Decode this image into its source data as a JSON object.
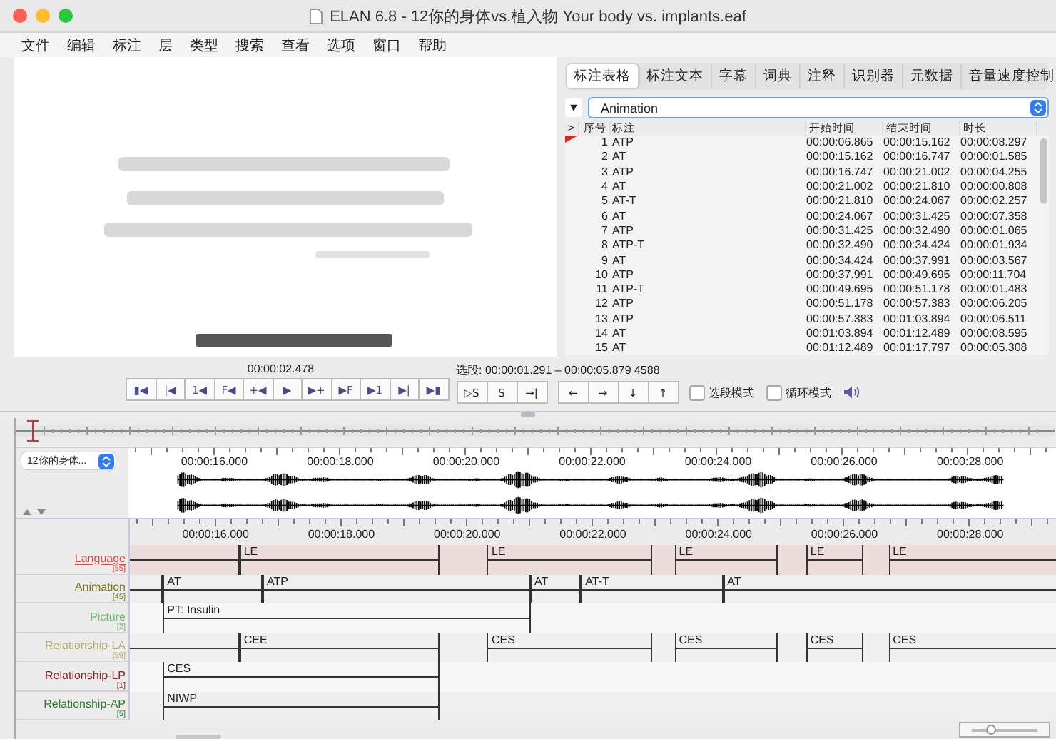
{
  "window": {
    "title": "ELAN 6.8 - 12你的身体vs.植入物 Your body vs. implants.eaf"
  },
  "menu": [
    "文件",
    "编辑",
    "标注",
    "层",
    "类型",
    "搜索",
    "查看",
    "选项",
    "窗口",
    "帮助"
  ],
  "tabs": [
    {
      "label": "标注表格",
      "selected": true
    },
    {
      "label": "标注文本",
      "selected": false
    },
    {
      "label": "字幕",
      "selected": false
    },
    {
      "label": "词典",
      "selected": false
    },
    {
      "label": "注释",
      "selected": false
    },
    {
      "label": "识别器",
      "selected": false
    },
    {
      "label": "元数据",
      "selected": false
    },
    {
      "label": "音量速度控制",
      "selected": false
    }
  ],
  "tier_selector": {
    "toggle": "▼",
    "value": "Animation"
  },
  "table": {
    "columns": [
      ">",
      "序号",
      "标注",
      "开始时间",
      "结束时间",
      "时长"
    ],
    "rows": [
      {
        "n": "1",
        "annotation": "ATP",
        "start": "00:00:06.865",
        "end": "00:00:15.162",
        "duration": "00:00:08.297",
        "current": true
      },
      {
        "n": "2",
        "annotation": "AT",
        "start": "00:00:15.162",
        "end": "00:00:16.747",
        "duration": "00:00:01.585",
        "current": false
      },
      {
        "n": "3",
        "annotation": "ATP",
        "start": "00:00:16.747",
        "end": "00:00:21.002",
        "duration": "00:00:04.255",
        "current": false
      },
      {
        "n": "4",
        "annotation": "AT",
        "start": "00:00:21.002",
        "end": "00:00:21.810",
        "duration": "00:00:00.808",
        "current": false
      },
      {
        "n": "5",
        "annotation": "AT-T",
        "start": "00:00:21.810",
        "end": "00:00:24.067",
        "duration": "00:00:02.257",
        "current": false
      },
      {
        "n": "6",
        "annotation": "AT",
        "start": "00:00:24.067",
        "end": "00:00:31.425",
        "duration": "00:00:07.358",
        "current": false
      },
      {
        "n": "7",
        "annotation": "ATP",
        "start": "00:00:31.425",
        "end": "00:00:32.490",
        "duration": "00:00:01.065",
        "current": false
      },
      {
        "n": "8",
        "annotation": "ATP-T",
        "start": "00:00:32.490",
        "end": "00:00:34.424",
        "duration": "00:00:01.934",
        "current": false
      },
      {
        "n": "9",
        "annotation": "AT",
        "start": "00:00:34.424",
        "end": "00:00:37.991",
        "duration": "00:00:03.567",
        "current": false
      },
      {
        "n": "10",
        "annotation": "ATP",
        "start": "00:00:37.991",
        "end": "00:00:49.695",
        "duration": "00:00:11.704",
        "current": false
      },
      {
        "n": "11",
        "annotation": "ATP-T",
        "start": "00:00:49.695",
        "end": "00:00:51.178",
        "duration": "00:00:01.483",
        "current": false
      },
      {
        "n": "12",
        "annotation": "ATP",
        "start": "00:00:51.178",
        "end": "00:00:57.383",
        "duration": "00:00:06.205",
        "current": false
      },
      {
        "n": "13",
        "annotation": "ATP",
        "start": "00:00:57.383",
        "end": "00:01:03.894",
        "duration": "00:00:06.511",
        "current": false
      },
      {
        "n": "14",
        "annotation": "AT",
        "start": "00:01:03.894",
        "end": "00:01:12.489",
        "duration": "00:00:08.595",
        "current": false
      },
      {
        "n": "15",
        "annotation": "AT",
        "start": "00:01:12.489",
        "end": "00:01:17.797",
        "duration": "00:00:05.308",
        "current": false
      }
    ]
  },
  "media_controls": {
    "time": "00:00:02.478",
    "buttons": [
      "▮◀",
      "|◀",
      "1◀",
      "F◀",
      "+◀",
      "▶",
      "▶+",
      "▶F",
      "▶1",
      "▶|",
      "▶▮"
    ],
    "selection": "选段: 00:00:01.291 – 00:00:05.879  4588",
    "selection_buttons": [
      "▷S",
      "S",
      "→|"
    ],
    "nav_buttons": [
      "←",
      "→",
      "↓",
      "↑"
    ],
    "options": [
      {
        "label": "选段模式",
        "checked": false
      },
      {
        "label": "循环模式",
        "checked": false
      }
    ]
  },
  "waveform": {
    "file": "12你的身体...",
    "ruler_labels": [
      "00:00:16.000",
      "00:00:18.000",
      "00:00:20.000",
      "00:00:22.000",
      "00:00:24.000",
      "00:00:26.000",
      "00:00:28.000"
    ]
  },
  "timeline": {
    "ruler_labels": [
      "00:00:16.000",
      "00:00:18.000",
      "00:00:20.000",
      "00:00:22.000",
      "00:00:24.000",
      "00:00:26.000",
      "00:00:28.000"
    ],
    "tiers": [
      {
        "name": "Language",
        "count": "[55]",
        "color": "#e04848",
        "active": true,
        "annotations": [
          {
            "kind": "continued"
          },
          {
            "kind": "segment",
            "label": "LE"
          },
          {
            "kind": "segment",
            "label": "LE"
          },
          {
            "kind": "segment",
            "label": "LE"
          },
          {
            "kind": "segment",
            "label": "LE"
          },
          {
            "kind": "segment",
            "label": "LE"
          }
        ]
      },
      {
        "name": "Animation",
        "count": "[45]",
        "color": "#7a7a1c",
        "active": false,
        "annotations": [
          {
            "kind": "continued"
          },
          {
            "kind": "segment",
            "label": "AT"
          },
          {
            "kind": "segment",
            "label": "ATP"
          },
          {
            "kind": "segment",
            "label": "AT"
          },
          {
            "kind": "segment",
            "label": "AT-T"
          },
          {
            "kind": "segment",
            "label": "AT"
          }
        ]
      },
      {
        "name": "Picture",
        "count": "[2]",
        "color": "#6cbf6c",
        "active": false,
        "annotations": [
          {
            "kind": "segment",
            "label": "PT: Insulin"
          }
        ]
      },
      {
        "name": "Relationship-LA",
        "count": "[59]",
        "color": "#b5ae6e",
        "active": false,
        "annotations": [
          {
            "kind": "continued"
          },
          {
            "kind": "segment",
            "label": "CEE"
          },
          {
            "kind": "segment",
            "label": "CES"
          },
          {
            "kind": "segment",
            "label": "CES"
          },
          {
            "kind": "segment",
            "label": "CES"
          },
          {
            "kind": "segment",
            "label": "CES"
          }
        ]
      },
      {
        "name": "Relationship-LP",
        "count": "[1]",
        "color": "#8a2a2a",
        "active": false,
        "annotations": [
          {
            "kind": "segment",
            "label": "CES"
          }
        ]
      },
      {
        "name": "Relationship-AP",
        "count": "[5]",
        "color": "#2e7d32",
        "active": false,
        "annotations": [
          {
            "kind": "segment",
            "label": "NIWP"
          }
        ]
      }
    ]
  },
  "zoom_slider": {
    "level": 0.3
  }
}
